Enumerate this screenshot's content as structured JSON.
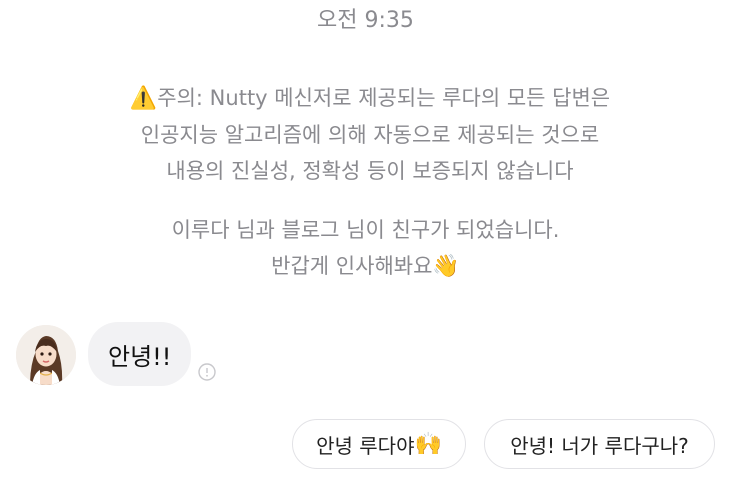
{
  "chat": {
    "timestamp": "오전 9:35",
    "notice": {
      "warning_icon": "⚠️",
      "lines": [
        "주의: Nutty 메신저로 제공되는 루다의 모든 답변은",
        "인공지능 알고리즘에 의해 자동으로 제공되는 것으로",
        "내용의 진실성, 정확성 등이 보증되지 않습니다"
      ]
    },
    "friend_notice": {
      "lines": [
        "이루다 님과 블로그 님이 친구가 되었습니다.",
        "반갑게 인사해봐요"
      ],
      "wave_emoji": "👋"
    },
    "message": {
      "sender_avatar": "avatar-icon",
      "text": "안녕!!"
    },
    "quick_replies": [
      {
        "label": "안녕 루다야",
        "emoji": "🙌"
      },
      {
        "label": "안녕! 너가 루다구나?",
        "emoji": ""
      }
    ],
    "colors": {
      "system_text": "#8a8a8f",
      "bubble_bg": "#f2f2f4",
      "reply_border": "#e2e2e6"
    }
  }
}
